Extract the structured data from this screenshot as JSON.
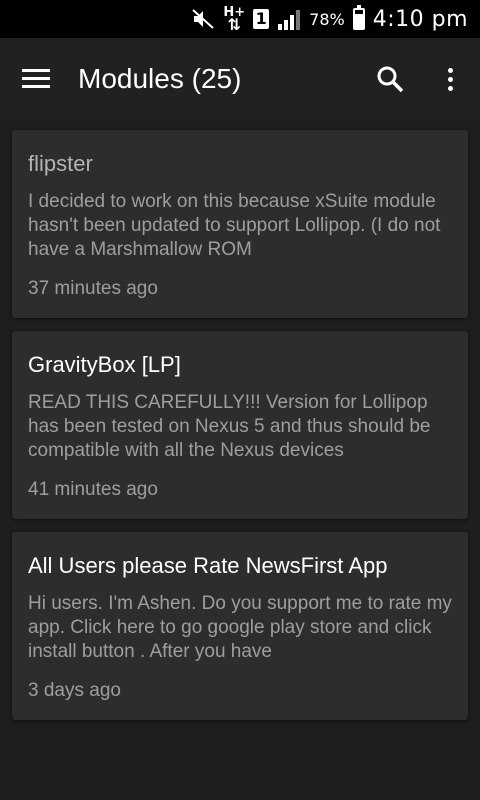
{
  "status_bar": {
    "network": "H+",
    "sim": "1",
    "battery": "78%",
    "battery_level": 0.78,
    "time": "4:10 pm"
  },
  "app_bar": {
    "title": "Modules (25)",
    "icons": [
      "menu-icon",
      "search-icon",
      "more-vert-icon"
    ]
  },
  "modules": [
    {
      "title": "flipster",
      "description": "I decided to work on this because xSuite module hasn't been updated to support Lollipop. (I do not have a Marshmallow ROM",
      "time": "37 minutes ago"
    },
    {
      "title": "GravityBox [LP]",
      "description": "READ THIS CAREFULLY!!! Version for Lollipop has been tested on Nexus 5 and thus should be compatible with all the Nexus devices",
      "time": "41 minutes ago"
    },
    {
      "title": "All Users please Rate NewsFirst App",
      "description": "Hi users. I'm Ashen. Do you support me to rate my app. Click here to go google play store and click install button . After you have",
      "time": "3 days ago"
    }
  ]
}
